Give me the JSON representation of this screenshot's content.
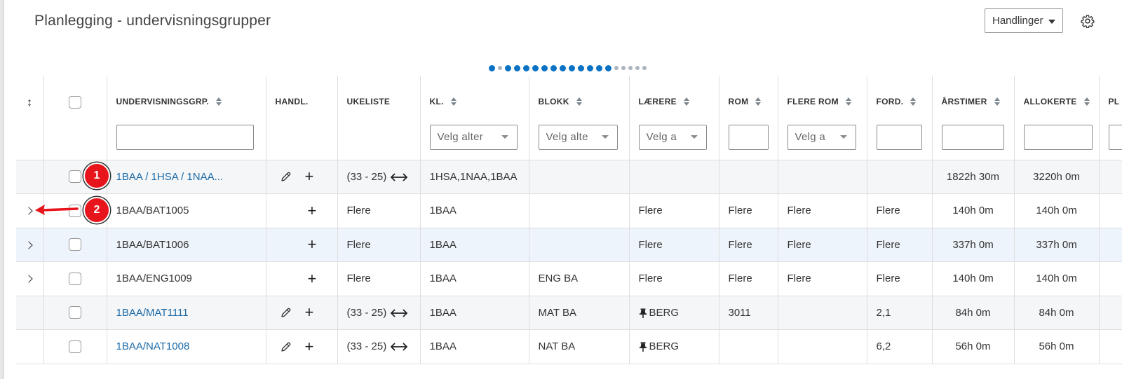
{
  "page": {
    "title": "Planlegging - undervisningsgrupper",
    "actions_label": "Handlinger",
    "settings_icon": "gear-icon"
  },
  "pager": {
    "total_dots": 19,
    "active_dots": 14
  },
  "table": {
    "columns": [
      {
        "key": "expand",
        "label": ""
      },
      {
        "key": "select",
        "label": ""
      },
      {
        "key": "group",
        "label": "UNDERVISNINGSGRP.",
        "sortable": true,
        "filter": "text",
        "filter_placeholder": ""
      },
      {
        "key": "handl",
        "label": "HANDL.",
        "sortable": false
      },
      {
        "key": "ukeliste",
        "label": "UKELISTE",
        "sortable": false
      },
      {
        "key": "kl",
        "label": "KL.",
        "sortable": true,
        "filter": "select",
        "filter_placeholder": "Velg alter"
      },
      {
        "key": "blokk",
        "label": "BLOKK",
        "sortable": true,
        "filter": "select",
        "filter_placeholder": "Velg alte"
      },
      {
        "key": "laerere",
        "label": "LÆRERE",
        "sortable": true,
        "filter": "select",
        "filter_placeholder": "Velg a"
      },
      {
        "key": "rom",
        "label": "ROM",
        "sortable": true,
        "filter": "text",
        "filter_placeholder": ""
      },
      {
        "key": "flere_rom",
        "label": "FLERE ROM",
        "sortable": true,
        "filter": "select",
        "filter_placeholder": "Velg a"
      },
      {
        "key": "ford",
        "label": "FORD.",
        "sortable": true,
        "filter": "text",
        "filter_placeholder": ""
      },
      {
        "key": "arstimer",
        "label": "ÅRSTIMER",
        "sortable": true,
        "filter": "text",
        "filter_placeholder": ""
      },
      {
        "key": "allokerte",
        "label": "ALLOKERTE",
        "sortable": true,
        "filter": "text",
        "filter_placeholder": ""
      },
      {
        "key": "pl",
        "label": "PL",
        "sortable": false,
        "filter": "text",
        "filter_placeholder": ""
      }
    ],
    "rows": [
      {
        "expandable": false,
        "group": "1BAA / 1HSA / 1NAA...",
        "group_link": true,
        "edit": true,
        "ukeliste": "(33 - 25)",
        "ukeliste_arrow": true,
        "kl": "1HSA,1NAA,1BAA",
        "blokk": "",
        "laerere": "",
        "laerere_pinned": false,
        "rom": "",
        "flere_rom": "",
        "ford": "",
        "arstimer": "1822h 30m",
        "allokerte": "3220h 0m",
        "style": "gray"
      },
      {
        "expandable": true,
        "group": "1BAA/BAT1005",
        "group_link": false,
        "edit": false,
        "ukeliste": "Flere",
        "ukeliste_arrow": false,
        "kl": "1BAA",
        "blokk": "",
        "laerere": "Flere",
        "laerere_pinned": false,
        "rom": "Flere",
        "flere_rom": "Flere",
        "ford": "Flere",
        "arstimer": "140h 0m",
        "allokerte": "140h 0m",
        "style": "white"
      },
      {
        "expandable": true,
        "group": "1BAA/BAT1006",
        "group_link": false,
        "edit": false,
        "ukeliste": "Flere",
        "ukeliste_arrow": false,
        "kl": "1BAA",
        "blokk": "",
        "laerere": "Flere",
        "laerere_pinned": false,
        "rom": "Flere",
        "flere_rom": "Flere",
        "ford": "Flere",
        "arstimer": "337h 0m",
        "allokerte": "337h 0m",
        "style": "blue"
      },
      {
        "expandable": true,
        "group": "1BAA/ENG1009",
        "group_link": false,
        "edit": false,
        "ukeliste": "Flere",
        "ukeliste_arrow": false,
        "kl": "1BAA",
        "blokk": "ENG BA",
        "laerere": "Flere",
        "laerere_pinned": false,
        "rom": "Flere",
        "flere_rom": "Flere",
        "ford": "Flere",
        "arstimer": "140h 0m",
        "allokerte": "140h 0m",
        "style": "white"
      },
      {
        "expandable": false,
        "group": "1BAA/MAT1111",
        "group_link": true,
        "edit": true,
        "ukeliste": "(33 - 25)",
        "ukeliste_arrow": true,
        "kl": "1BAA",
        "blokk": "MAT BA",
        "laerere": "BERG",
        "laerere_pinned": true,
        "rom": "3011",
        "flere_rom": "",
        "ford": "2,1",
        "arstimer": "84h 0m",
        "allokerte": "84h 0m",
        "style": "gray"
      },
      {
        "expandable": false,
        "group": "1BAA/NAT1008",
        "group_link": true,
        "edit": true,
        "ukeliste": "(33 - 25)",
        "ukeliste_arrow": true,
        "kl": "1BAA",
        "blokk": "NAT BA",
        "laerere": "BERG",
        "laerere_pinned": true,
        "rom": "",
        "flere_rom": "",
        "ford": "6,2",
        "arstimer": "56h 0m",
        "allokerte": "56h 0m",
        "style": "white"
      }
    ]
  },
  "annotations": [
    {
      "label": "1",
      "color": "#e8141c"
    },
    {
      "label": "2",
      "color": "#e8141c"
    }
  ]
}
